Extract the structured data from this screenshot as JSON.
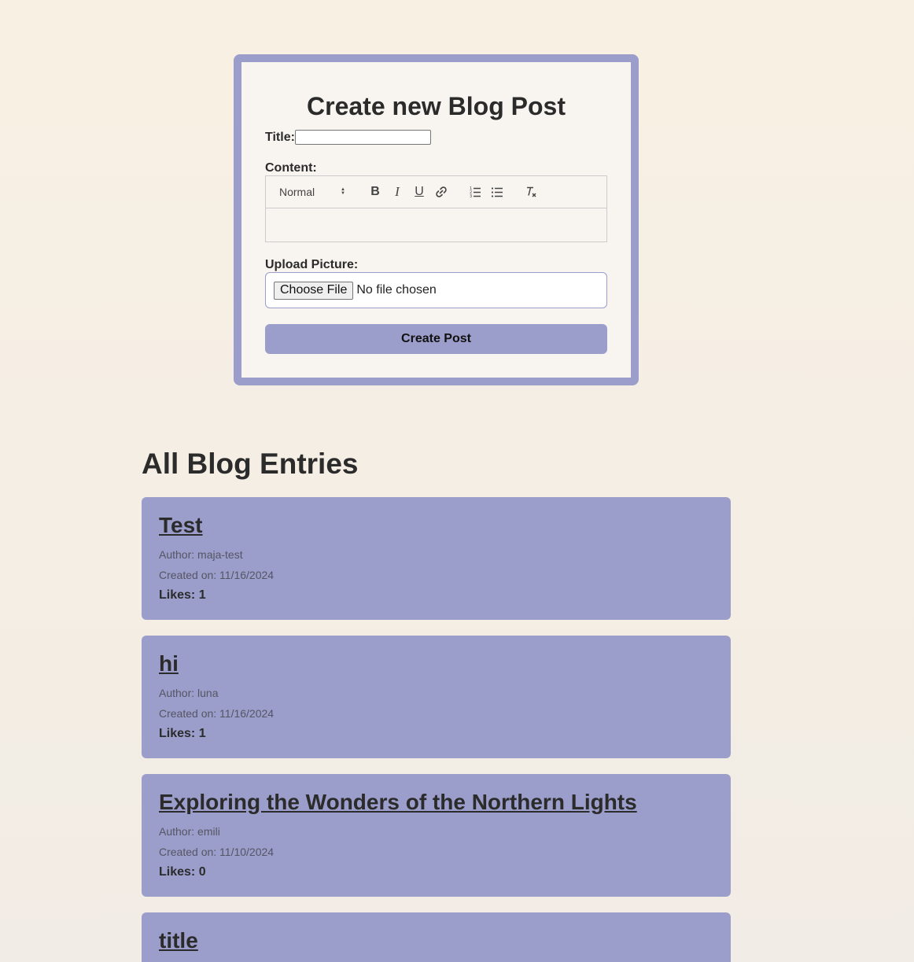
{
  "form": {
    "heading": "Create new Blog Post",
    "title_label": "Title:",
    "title_value": "",
    "content_label": "Content:",
    "editor_toolbar": {
      "format_select": "Normal",
      "bold_icon": "B",
      "italic_icon": "I",
      "underline_icon": "U"
    },
    "content_value": "",
    "upload_label": "Upload Picture:",
    "file_button": "Choose File",
    "file_status": "No file chosen",
    "submit_label": "Create Post"
  },
  "entries": {
    "heading": "All Blog Entries",
    "items": [
      {
        "title": "Test",
        "author": "Author: maja-test",
        "created": "Created on: 11/16/2024",
        "likes": "Likes: 1"
      },
      {
        "title": "hi",
        "author": "Author: luna",
        "created": "Created on: 11/16/2024",
        "likes": "Likes: 1"
      },
      {
        "title": "Exploring the Wonders of the Northern Lights",
        "author": "Author: emili",
        "created": "Created on: 11/10/2024",
        "likes": "Likes: 0"
      },
      {
        "title": "title"
      }
    ]
  },
  "colors": {
    "accent": "#9b9dca",
    "background": "#f8f0e3",
    "card_background": "#f8f5f0",
    "text": "#2b2b2b"
  }
}
